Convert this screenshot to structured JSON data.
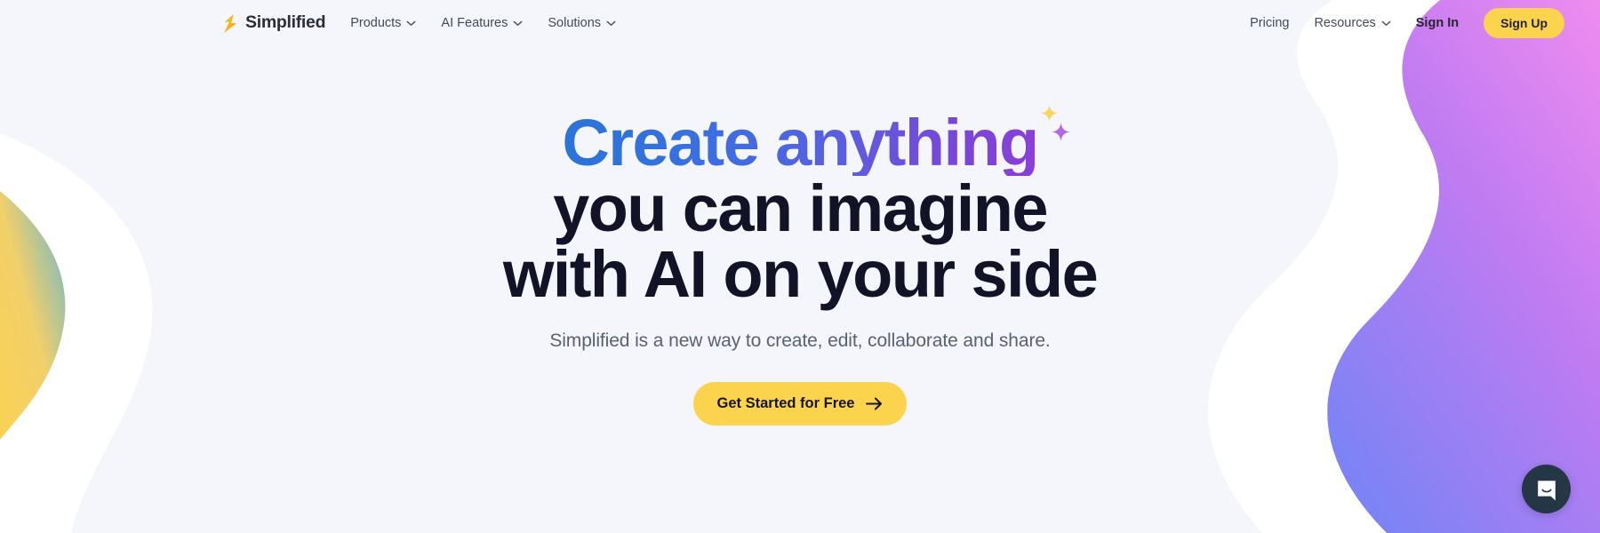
{
  "page": {
    "background_color": "#f4f6fb",
    "accent_yellow": "#fcd34d",
    "heading_gradient_start": "#2a74d8",
    "heading_gradient_end": "#8a3fd6",
    "heading_dark": "#121327"
  },
  "nav": {
    "brand": {
      "name": "Simplified",
      "mark_icon": "lightning-bolt-icon"
    },
    "links": [
      {
        "label": "Products",
        "has_dropdown": true,
        "icon": "chevron-down-icon"
      },
      {
        "label": "AI Features",
        "has_dropdown": true,
        "icon": "chevron-down-icon"
      },
      {
        "label": "Solutions",
        "has_dropdown": true,
        "icon": "chevron-down-icon"
      },
      {
        "label": "Pricing",
        "has_dropdown": false,
        "icon": ""
      },
      {
        "label": "Resources",
        "has_dropdown": true,
        "icon": "chevron-down-icon"
      }
    ],
    "sign_in_label": "Sign In",
    "sign_up_label": "Sign Up"
  },
  "hero": {
    "headline_line1": "Create anything",
    "headline_line2": "you can imagine",
    "headline_line3": "with AI on your side",
    "sparkle_yellow_icon": "sparkle-star-icon",
    "sparkle_purple_icon": "sparkle-star-icon",
    "sparkle_yellow_color": "#fbd45e",
    "sparkle_purple_color": "#b368e0",
    "subtitle": "Simplified is a new way to create, edit, collaborate and share.",
    "cta_label": "Get Started for Free",
    "cta_icon": "arrow-right-icon"
  },
  "chat": {
    "icon": "chat-bubble-smile-icon",
    "background_color": "#253745"
  },
  "decor": {
    "right_blob_gradient_start": "#e989f0",
    "right_blob_gradient_end": "#7d83f5",
    "left_blob_gradient_start": "#fbd24e",
    "left_blob_gradient_end": "#6fb8c9"
  }
}
